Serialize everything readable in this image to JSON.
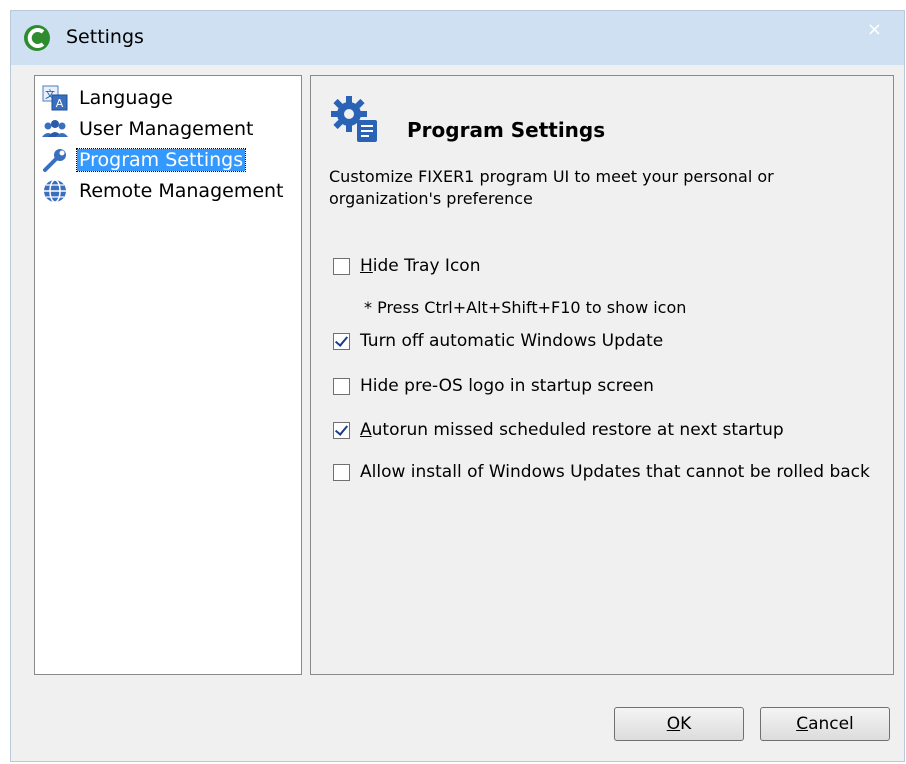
{
  "window": {
    "title": "Settings",
    "close_glyph": "×",
    "app_icon": "fixer1-app-icon"
  },
  "nav": {
    "items": [
      {
        "label": "Language",
        "icon": "language-icon",
        "selected": false
      },
      {
        "label": "User Management",
        "icon": "users-icon",
        "selected": false
      },
      {
        "label": "Program Settings",
        "icon": "wrench-icon",
        "selected": true
      },
      {
        "label": "Remote Management",
        "icon": "globe-icon",
        "selected": false
      }
    ]
  },
  "content": {
    "title": "Program Settings",
    "header_icon": "gear-settings-icon",
    "description": "Customize FIXER1 program UI to meet your personal or organization's preference",
    "options": [
      {
        "label_access": "H",
        "label_rest": "ide Tray Icon",
        "checked": false
      },
      {
        "label_access": "",
        "label_rest": "Turn off automatic Windows Update",
        "checked": true
      },
      {
        "label_access": "",
        "label_rest": "Hide pre-OS logo in startup screen",
        "checked": false
      },
      {
        "label_access": "A",
        "label_rest": "utorun missed scheduled restore at next startup",
        "checked": true
      },
      {
        "label_access": "",
        "label_rest": "Allow install of Windows Updates that cannot be rolled back",
        "checked": false
      }
    ],
    "hint": "* Press Ctrl+Alt+Shift+F10 to show icon"
  },
  "buttons": {
    "ok_access": "O",
    "ok_rest": "K",
    "cancel_access": "C",
    "cancel_rest": "ancel"
  },
  "colors": {
    "titlebar": "#cfe0f3",
    "selection": "#3399ff",
    "brand_green": "#2e8b2e"
  }
}
